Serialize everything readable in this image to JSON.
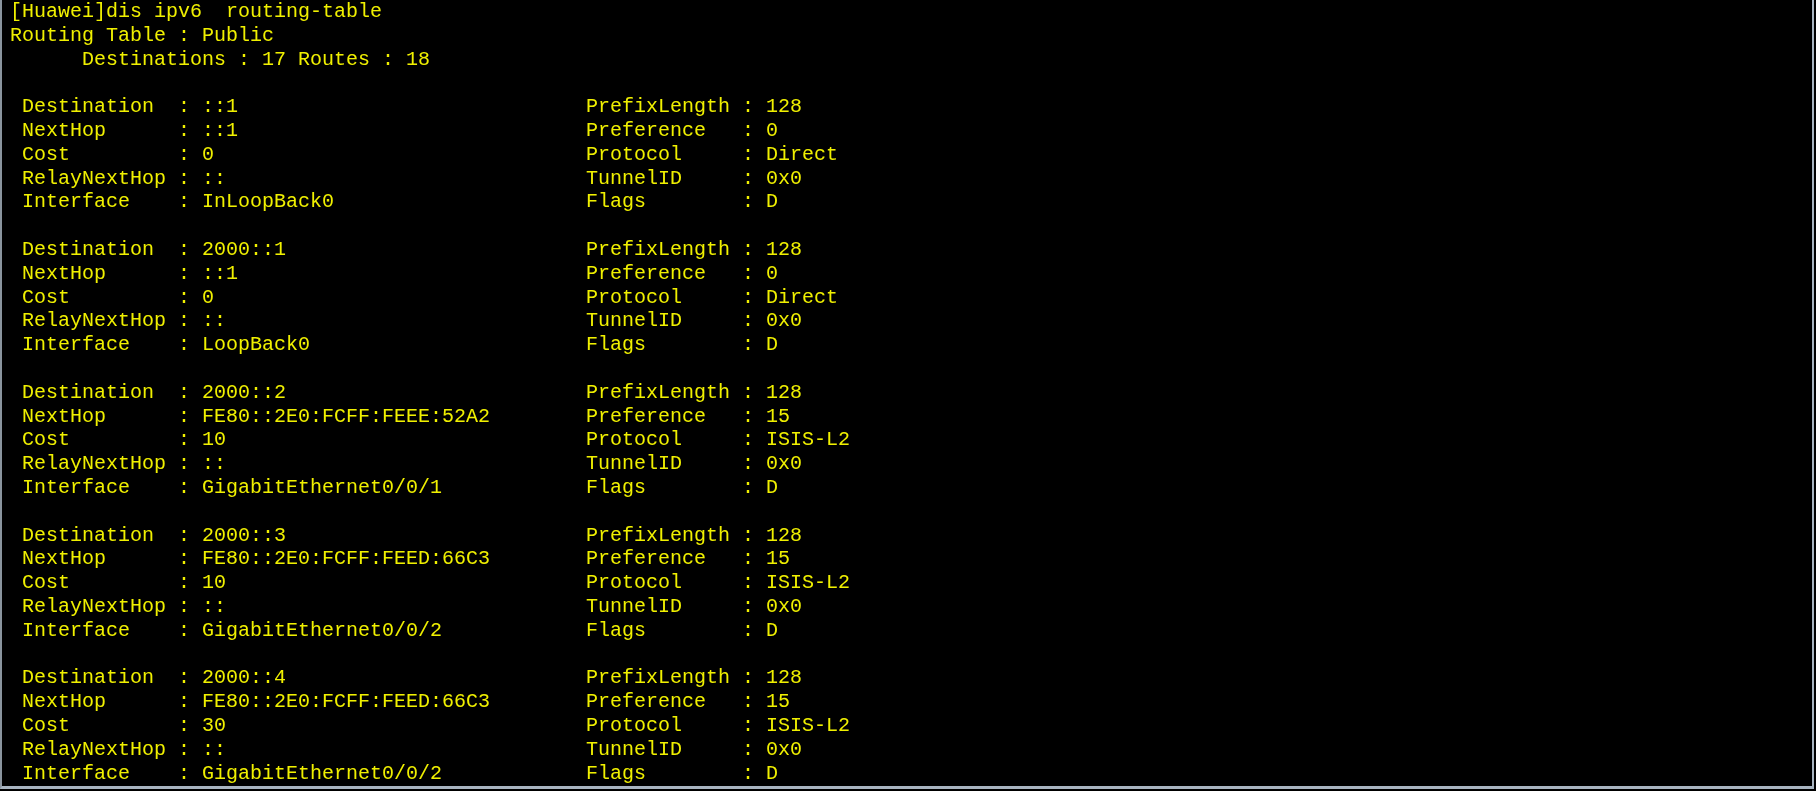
{
  "terminal": {
    "lines": [
      "[Huawei]dis ipv6  routing-table",
      "Routing Table : Public",
      "      Destinations : 17 Routes : 18"
    ],
    "routes": [
      {
        "left": [
          "Destination  : ::1",
          "NextHop      : ::1",
          "Cost         : 0",
          "RelayNextHop : ::",
          "Interface    : InLoopBack0"
        ],
        "right": [
          "PrefixLength : 128",
          "Preference   : 0",
          "Protocol     : Direct",
          "TunnelID     : 0x0",
          "Flags        : D"
        ]
      },
      {
        "left": [
          "Destination  : 2000::1",
          "NextHop      : ::1",
          "Cost         : 0",
          "RelayNextHop : ::",
          "Interface    : LoopBack0"
        ],
        "right": [
          "PrefixLength : 128",
          "Preference   : 0",
          "Protocol     : Direct",
          "TunnelID     : 0x0",
          "Flags        : D"
        ]
      },
      {
        "left": [
          "Destination  : 2000::2",
          "NextHop      : FE80::2E0:FCFF:FEEE:52A2",
          "Cost         : 10",
          "RelayNextHop : ::",
          "Interface    : GigabitEthernet0/0/1"
        ],
        "right": [
          "PrefixLength : 128",
          "Preference   : 15",
          "Protocol     : ISIS-L2",
          "TunnelID     : 0x0",
          "Flags        : D"
        ]
      },
      {
        "left": [
          "Destination  : 2000::3",
          "NextHop      : FE80::2E0:FCFF:FEED:66C3",
          "Cost         : 10",
          "RelayNextHop : ::",
          "Interface    : GigabitEthernet0/0/2"
        ],
        "right": [
          "PrefixLength : 128",
          "Preference   : 15",
          "Protocol     : ISIS-L2",
          "TunnelID     : 0x0",
          "Flags        : D"
        ]
      },
      {
        "left": [
          "Destination  : 2000::4",
          "NextHop      : FE80::2E0:FCFF:FEED:66C3",
          "Cost         : 30",
          "RelayNextHop : ::",
          "Interface    : GigabitEthernet0/0/2"
        ],
        "right": [
          "PrefixLength : 128",
          "Preference   : 15",
          "Protocol     : ISIS-L2",
          "TunnelID     : 0x0",
          "Flags        : D"
        ]
      }
    ]
  }
}
